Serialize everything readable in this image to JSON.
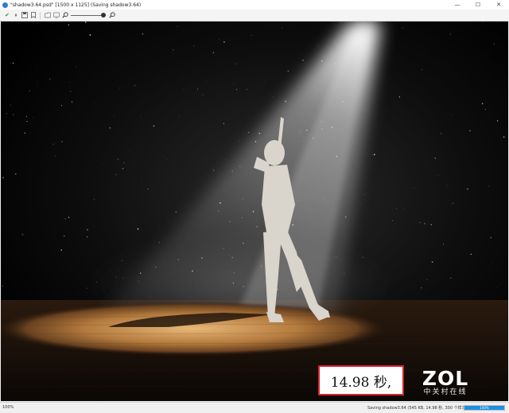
{
  "window": {
    "title": "\"shadow3.64.psd\" [1500 x 1125] (Saving shadow3.64)",
    "controls": {
      "minimize": "—",
      "maximize": "☐",
      "close": "✕"
    }
  },
  "toolbar": {
    "icons": [
      "check-icon",
      "stop-icon",
      "save-icon",
      "bookmark-icon",
      "folder-icon",
      "screen-icon",
      "zoom-out-icon",
      "zoom-in-icon"
    ],
    "zoom_level": 1.0
  },
  "overlay": {
    "render_time": "14.98 秒,",
    "logo": {
      "main": "ZOL",
      "sub": "中关村在线"
    }
  },
  "status": {
    "zoom": "100%",
    "message": "Saving shadow3.64 (545 KB, 14.98 秒, 300 个样本)",
    "progress": 1.0,
    "progress_label": "100%"
  },
  "colors": {
    "accent": "#1e8fe0",
    "highlight_border": "#d8202a",
    "floor": "#8a5a2a"
  }
}
